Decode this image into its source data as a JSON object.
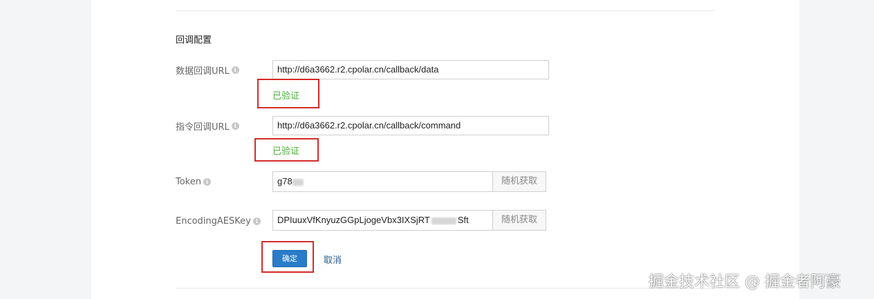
{
  "section_title": "回调配置",
  "data_callback": {
    "label": "数据回调URL",
    "value": "http://d6a3662.r2.cpolar.cn/callback/data",
    "status": "已验证"
  },
  "command_callback": {
    "label": "指令回调URL",
    "value": "http://d6a3662.r2.cpolar.cn/callback/command",
    "status": "已验证"
  },
  "token": {
    "label": "Token",
    "value_visible": "g78",
    "random_button": "随机获取"
  },
  "aes_key": {
    "label": "EncodingAESKey",
    "value_visible_start": "DPIuuxVfKnyuzGGpLjogeVbx3IXSjRT",
    "value_visible_end": "Sft",
    "random_button": "随机获取"
  },
  "actions": {
    "confirm": "确定",
    "cancel": "取消"
  },
  "watermark": "掘金技术社区 @ 掘金者阿豪",
  "colors": {
    "verified": "#4cae3a",
    "primary": "#2a7cc9",
    "highlight_box": "#d52a2a",
    "link": "#2a5c8a"
  },
  "icons": {
    "info": "info-circle-icon"
  }
}
